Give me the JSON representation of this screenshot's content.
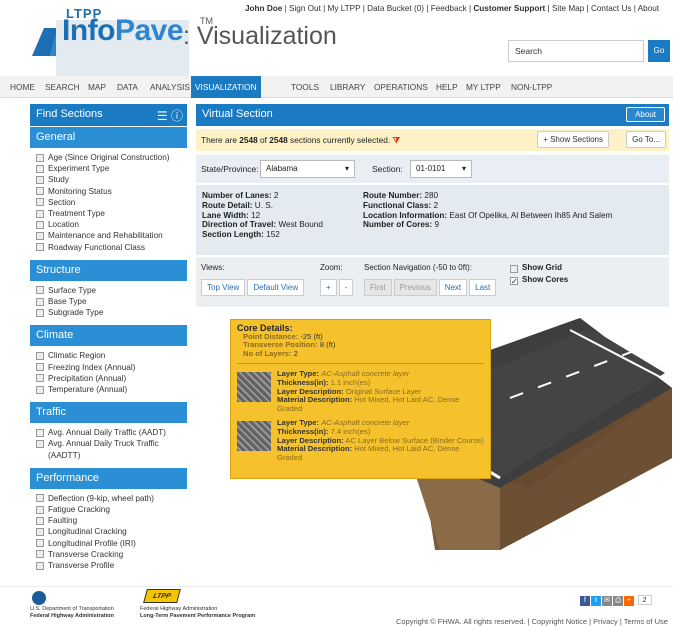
{
  "topnav": {
    "user": "John Doe",
    "signout": "Sign Out",
    "myltpp": "My LTPP",
    "bucket": "Data Bucket (0)",
    "feedback": "Feedback",
    "support": "Customer Support",
    "sitemap": "Site Map",
    "contact": "Contact Us",
    "about": "About"
  },
  "logo": {
    "ltpp": "LTPP",
    "info": "Info",
    "pave": "Pave",
    "tm": "TM",
    "viz": ": Visualization"
  },
  "search": {
    "placeholder": "Search",
    "go": "Go"
  },
  "nav": [
    "HOME",
    "SEARCH",
    "MAP",
    "DATA",
    "ANALYSIS",
    "VISUALIZATION",
    "TOOLS",
    "LIBRARY",
    "OPERATIONS",
    "HELP",
    "MY LTPP",
    "NON-LTPP"
  ],
  "sidebar": {
    "find": "Find Sections",
    "sections": [
      {
        "title": "General",
        "items": [
          "Age (Since Original Construction)",
          "Experiment Type",
          "Study",
          "Monitoring Status",
          "Section",
          "Treatment Type",
          "Location",
          "Maintenance and Rehabilitation",
          "Roadway Functional Class"
        ]
      },
      {
        "title": "Structure",
        "items": [
          "Surface Type",
          "Base Type",
          "Subgrade Type"
        ]
      },
      {
        "title": "Climate",
        "items": [
          "Climatic Region",
          "Freezing Index (Annual)",
          "Precipitation (Annual)",
          "Temperature (Annual)"
        ]
      },
      {
        "title": "Traffic",
        "items": [
          "Avg. Annual Daily Traffic (AADT)",
          "Avg. Annual Daily Truck Traffic (AADTT)"
        ]
      },
      {
        "title": "Performance",
        "items": [
          "Deflection (9-kip, wheel path)",
          "Fatigue Cracking",
          "Faulting",
          "Longitudinal Cracking",
          "Longitudinal Profile (IRI)",
          "Transverse Cracking",
          "Transverse Profile"
        ]
      }
    ]
  },
  "main": {
    "title": "Virtual Section",
    "about": "About",
    "sel_pre": "There are ",
    "sel_count": "2548",
    "sel_mid": " of ",
    "sel_total": "2548",
    "sel_post": " sections currently selected.",
    "show_sections": "+ Show Sections",
    "goto": "Go To...",
    "state_label": "State/Province:",
    "state_value": "Alabama",
    "section_label": "Section:",
    "section_value": "01-0101",
    "info": {
      "lanes_l": "Number of Lanes:",
      "lanes": "2",
      "route_detail_l": "Route Detail:",
      "route_detail": "U. S.",
      "lane_width_l": "Lane Width:",
      "lane_width": "12",
      "dir_l": "Direction of Travel:",
      "dir": "West Bound",
      "len_l": "Section Length:",
      "len": "152",
      "route_num_l": "Route Number:",
      "route_num": "280",
      "func_l": "Functional Class:",
      "func": "2",
      "loc_l": "Location Information:",
      "loc": "East Of Opelika, Al Between Ih85 And Salem",
      "cores_l": "Number of Cores:",
      "cores": "9"
    },
    "views_label": "Views:",
    "top_view": "Top View",
    "default_view": "Default View",
    "zoom_label": "Zoom:",
    "zoom_in": "+",
    "zoom_out": "-",
    "nav_label": "Section Navigation (-50 to 0ft):",
    "first": "First",
    "previous": "Previous",
    "next": "Next",
    "last": "Last",
    "show_grid": "Show Grid",
    "show_cores": "Show Cores"
  },
  "core": {
    "title": "Core Details:",
    "pd_l": "Point Distance:",
    "pd": "-25 (ft)",
    "tp_l": "Transverse Position:",
    "tp": "8 (ft)",
    "nl_l": "No of Layers:",
    "nl": "2",
    "layers": [
      {
        "type": "AC-Asphalt concrete layer",
        "thick": "1.1 inch(es)",
        "desc": "Original Surface Layer",
        "mat": "Hot Mixed, Hot Laid AC, Dense Graded"
      },
      {
        "type": "AC-Asphalt concrete layer",
        "thick": "7.4 inch(es)",
        "desc": "AC Layer Below Surface (Binder Course)",
        "mat": "Hot Mixed, Hot Laid AC, Dense Graded"
      }
    ],
    "lbl_type": "Layer Type:",
    "lbl_thick": "Thickness(in):",
    "lbl_desc": "Layer Description:",
    "lbl_mat": "Material Description:"
  },
  "footer": {
    "dot1": "U.S. Department of Transportation",
    "dot2": "Federal Highway Administration",
    "ltpp": "LTPP",
    "f1": "Federal Highway Administration",
    "f2": "Long-Term Pavement Performance Program",
    "share_count": "2",
    "copyright": "Copyright © FHWA. All rights reserved.",
    "notice": "Copyright Notice",
    "privacy": "Privacy",
    "terms": "Terms of Use"
  }
}
